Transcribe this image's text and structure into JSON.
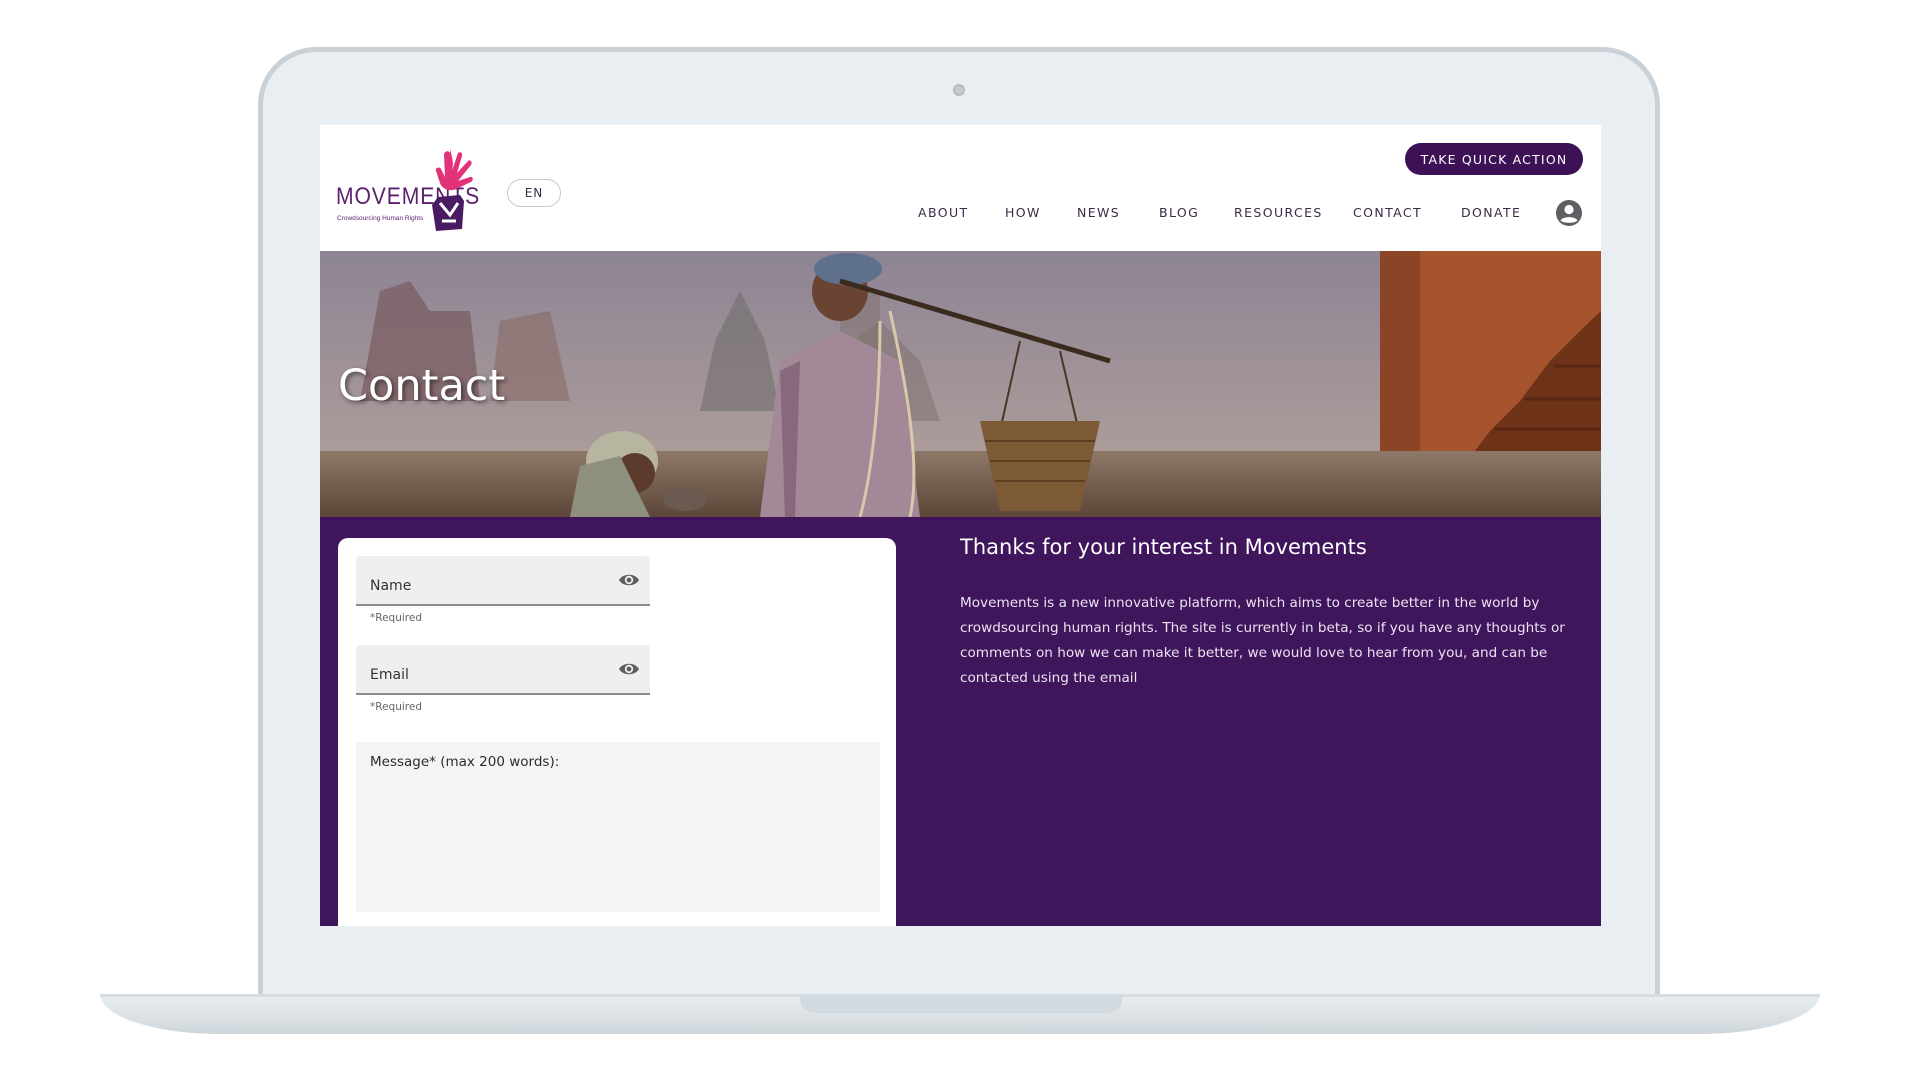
{
  "brand": {
    "logo_word": "MOVEMENTS",
    "logo_tagline": "Crowdsourcing Human Rights"
  },
  "header": {
    "language": "EN",
    "cta_label": "TAKE QUICK ACTION",
    "nav": [
      {
        "label": "ABOUT"
      },
      {
        "label": "HOW"
      },
      {
        "label": "NEWS"
      },
      {
        "label": "BLOG"
      },
      {
        "label": "RESOURCES"
      },
      {
        "label": "CONTACT"
      },
      {
        "label": "DONATE"
      }
    ]
  },
  "hero": {
    "title": "Contact"
  },
  "form": {
    "name_label": "Name",
    "name_helper": "*Required",
    "email_label": "Email",
    "email_helper": "*Required",
    "message_label": "Message* (max 200 words):"
  },
  "info": {
    "title": "Thanks for your interest in Movements",
    "body": "Movements is a new innovative platform, which aims to create better in the world by crowdsourcing human rights. The site is currently in beta, so if you have any thoughts or comments on how we can make it better, we would love to hear from you, and can be contacted using the email"
  },
  "colors": {
    "brand_purple": "#3f155c",
    "cta_purple": "#3e1157",
    "logo_pink": "#e2337a"
  },
  "icons": {
    "visibility": "eye-icon",
    "account": "account-circle-icon"
  }
}
